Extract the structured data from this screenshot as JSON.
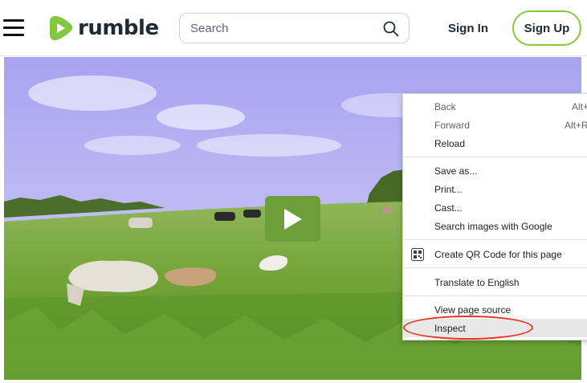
{
  "header": {
    "logo_text": "rumble",
    "search": {
      "placeholder": "Search",
      "value": ""
    },
    "signin_label": "Sign In",
    "signup_label": "Sign Up"
  },
  "colors": {
    "brand_green": "#85c742",
    "play_button": "#6a9f3a",
    "annotation_ring": "#e8341c"
  },
  "context_menu": {
    "items": [
      {
        "label": "Back",
        "shortcut": "Alt+",
        "enabled": false
      },
      {
        "label": "Forward",
        "shortcut": "Alt+R",
        "enabled": false
      },
      {
        "label": "Reload",
        "shortcut": "",
        "enabled": true
      },
      {
        "label": "Save as...",
        "shortcut": "",
        "enabled": true
      },
      {
        "label": "Print...",
        "shortcut": "",
        "enabled": true
      },
      {
        "label": "Cast...",
        "shortcut": "",
        "enabled": true
      },
      {
        "label": "Search images with Google",
        "shortcut": "",
        "enabled": true
      },
      {
        "label": "Create QR Code for this page",
        "shortcut": "",
        "enabled": true,
        "icon": "qr-code-icon"
      },
      {
        "label": "Translate to English",
        "shortcut": "",
        "enabled": true
      },
      {
        "label": "View page source",
        "shortcut": "",
        "enabled": true
      },
      {
        "label": "Inspect",
        "shortcut": "",
        "enabled": true,
        "highlighted": true
      }
    ]
  }
}
